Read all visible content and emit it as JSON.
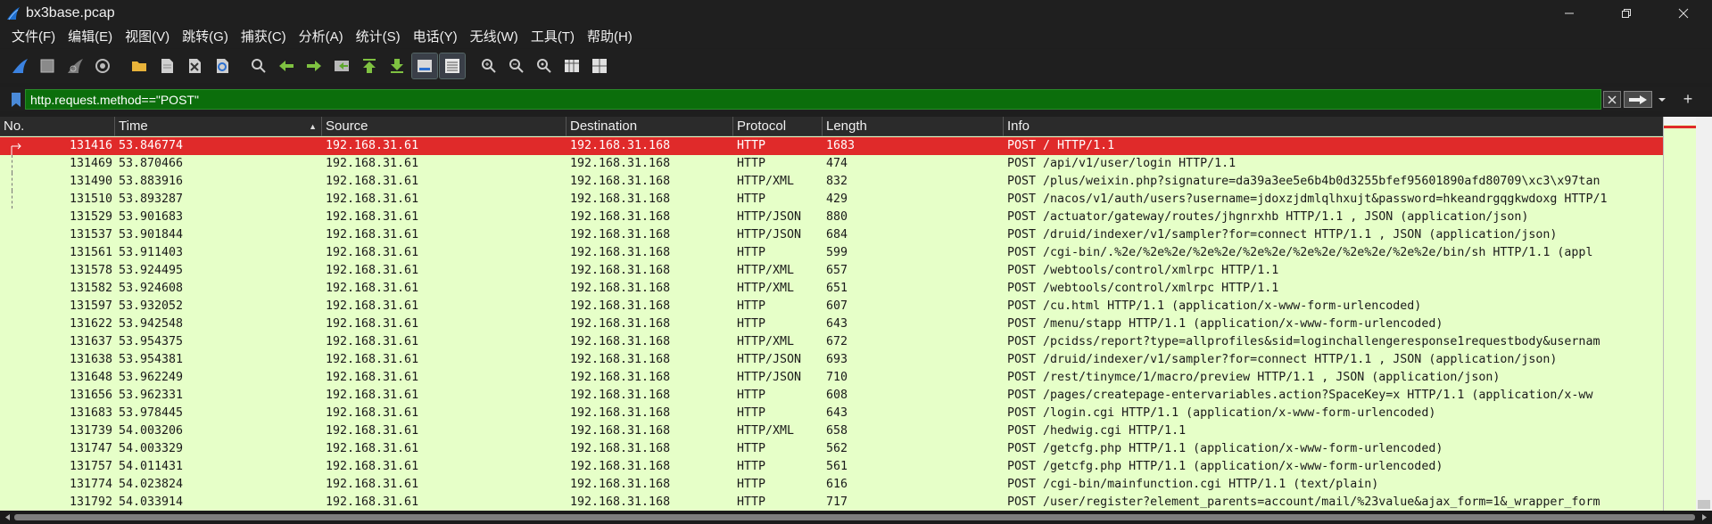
{
  "window": {
    "title": "bx3base.pcap",
    "minimize_icon": "minimize-icon",
    "maximize_icon": "restore-icon",
    "close_icon": "close-icon"
  },
  "menu": {
    "items": [
      {
        "label": "文件(F)"
      },
      {
        "label": "编辑(E)"
      },
      {
        "label": "视图(V)"
      },
      {
        "label": "跳转(G)"
      },
      {
        "label": "捕获(C)"
      },
      {
        "label": "分析(A)"
      },
      {
        "label": "统计(S)"
      },
      {
        "label": "电话(Y)"
      },
      {
        "label": "无线(W)"
      },
      {
        "label": "工具(T)"
      },
      {
        "label": "帮助(H)"
      }
    ]
  },
  "toolbar": {
    "buttons": [
      {
        "icon": "shark-fin-start-icon"
      },
      {
        "icon": "stop-square-icon"
      },
      {
        "icon": "restart-fin-icon"
      },
      {
        "icon": "capture-options-gear-icon"
      },
      {
        "icon": "open-folder-icon"
      },
      {
        "icon": "file-icon"
      },
      {
        "icon": "close-file-icon"
      },
      {
        "icon": "reload-icon"
      },
      {
        "icon": "search-icon"
      },
      {
        "icon": "back-arrow-icon"
      },
      {
        "icon": "forward-arrow-icon"
      },
      {
        "icon": "go-to-packet-icon"
      },
      {
        "icon": "first-packet-icon"
      },
      {
        "icon": "last-packet-icon"
      },
      {
        "icon": "autoscroll-icon"
      },
      {
        "icon": "colorize-icon"
      },
      {
        "icon": "zoom-in-icon"
      },
      {
        "icon": "zoom-out-icon"
      },
      {
        "icon": "zoom-reset-icon"
      },
      {
        "icon": "resize-columns-icon"
      },
      {
        "icon": "layout-icon"
      }
    ]
  },
  "filter": {
    "value": "http.request.method==\"POST\"",
    "background_color": "#0b6e0b"
  },
  "packet_list": {
    "columns": [
      "No.",
      "Time",
      "Source",
      "Destination",
      "Protocol",
      "Length",
      "Info"
    ],
    "sort_column": "Time",
    "selected_row_color": "#e02a2a",
    "row_color": "#e6ffc8",
    "rows": [
      {
        "no": "131416",
        "time": "53.846774",
        "src": "192.168.31.61",
        "dst": "192.168.31.168",
        "proto": "HTTP",
        "len": "1683",
        "info": "POST / HTTP/1.1",
        "selected": true
      },
      {
        "no": "131469",
        "time": "53.870466",
        "src": "192.168.31.61",
        "dst": "192.168.31.168",
        "proto": "HTTP",
        "len": "474",
        "info": "POST /api/v1/user/login HTTP/1.1"
      },
      {
        "no": "131490",
        "time": "53.883916",
        "src": "192.168.31.61",
        "dst": "192.168.31.168",
        "proto": "HTTP/XML",
        "len": "832",
        "info": "POST /plus/weixin.php?signature=da39a3ee5e6b4b0d3255bfef95601890afd80709\\xc3\\x97tan"
      },
      {
        "no": "131510",
        "time": "53.893287",
        "src": "192.168.31.61",
        "dst": "192.168.31.168",
        "proto": "HTTP",
        "len": "429",
        "info": "POST /nacos/v1/auth/users?username=jdoxzjdmlqlhxujt&password=hkeandrgqgkwdoxg HTTP/1"
      },
      {
        "no": "131529",
        "time": "53.901683",
        "src": "192.168.31.61",
        "dst": "192.168.31.168",
        "proto": "HTTP/JSON",
        "len": "880",
        "info": "POST /actuator/gateway/routes/jhgnrxhb HTTP/1.1 , JSON (application/json)"
      },
      {
        "no": "131537",
        "time": "53.901844",
        "src": "192.168.31.61",
        "dst": "192.168.31.168",
        "proto": "HTTP/JSON",
        "len": "684",
        "info": "POST /druid/indexer/v1/sampler?for=connect HTTP/1.1 , JSON (application/json)"
      },
      {
        "no": "131561",
        "time": "53.911403",
        "src": "192.168.31.61",
        "dst": "192.168.31.168",
        "proto": "HTTP",
        "len": "599",
        "info": "POST /cgi-bin/.%2e/%2e%2e/%2e%2e/%2e%2e/%2e%2e/%2e%2e/%2e%2e/bin/sh HTTP/1.1  (appl"
      },
      {
        "no": "131578",
        "time": "53.924495",
        "src": "192.168.31.61",
        "dst": "192.168.31.168",
        "proto": "HTTP/XML",
        "len": "657",
        "info": "POST /webtools/control/xmlrpc HTTP/1.1"
      },
      {
        "no": "131582",
        "time": "53.924608",
        "src": "192.168.31.61",
        "dst": "192.168.31.168",
        "proto": "HTTP/XML",
        "len": "651",
        "info": "POST /webtools/control/xmlrpc HTTP/1.1"
      },
      {
        "no": "131597",
        "time": "53.932052",
        "src": "192.168.31.61",
        "dst": "192.168.31.168",
        "proto": "HTTP",
        "len": "607",
        "info": "POST /cu.html HTTP/1.1  (application/x-www-form-urlencoded)"
      },
      {
        "no": "131622",
        "time": "53.942548",
        "src": "192.168.31.61",
        "dst": "192.168.31.168",
        "proto": "HTTP",
        "len": "643",
        "info": "POST /menu/stapp HTTP/1.1  (application/x-www-form-urlencoded)"
      },
      {
        "no": "131637",
        "time": "53.954375",
        "src": "192.168.31.61",
        "dst": "192.168.31.168",
        "proto": "HTTP/XML",
        "len": "672",
        "info": "POST /pcidss/report?type=allprofiles&sid=loginchallengeresponse1requestbody&usernam"
      },
      {
        "no": "131638",
        "time": "53.954381",
        "src": "192.168.31.61",
        "dst": "192.168.31.168",
        "proto": "HTTP/JSON",
        "len": "693",
        "info": "POST /druid/indexer/v1/sampler?for=connect HTTP/1.1 , JSON (application/json)"
      },
      {
        "no": "131648",
        "time": "53.962249",
        "src": "192.168.31.61",
        "dst": "192.168.31.168",
        "proto": "HTTP/JSON",
        "len": "710",
        "info": "POST /rest/tinymce/1/macro/preview HTTP/1.1 , JSON (application/json)"
      },
      {
        "no": "131656",
        "time": "53.962331",
        "src": "192.168.31.61",
        "dst": "192.168.31.168",
        "proto": "HTTP",
        "len": "608",
        "info": "POST /pages/createpage-entervariables.action?SpaceKey=x HTTP/1.1  (application/x-ww"
      },
      {
        "no": "131683",
        "time": "53.978445",
        "src": "192.168.31.61",
        "dst": "192.168.31.168",
        "proto": "HTTP",
        "len": "643",
        "info": "POST /login.cgi HTTP/1.1  (application/x-www-form-urlencoded)"
      },
      {
        "no": "131739",
        "time": "54.003206",
        "src": "192.168.31.61",
        "dst": "192.168.31.168",
        "proto": "HTTP/XML",
        "len": "658",
        "info": "POST /hedwig.cgi HTTP/1.1"
      },
      {
        "no": "131747",
        "time": "54.003329",
        "src": "192.168.31.61",
        "dst": "192.168.31.168",
        "proto": "HTTP",
        "len": "562",
        "info": "POST /getcfg.php HTTP/1.1  (application/x-www-form-urlencoded)"
      },
      {
        "no": "131757",
        "time": "54.011431",
        "src": "192.168.31.61",
        "dst": "192.168.31.168",
        "proto": "HTTP",
        "len": "561",
        "info": "POST /getcfg.php HTTP/1.1  (application/x-www-form-urlencoded)"
      },
      {
        "no": "131774",
        "time": "54.023824",
        "src": "192.168.31.61",
        "dst": "192.168.31.168",
        "proto": "HTTP",
        "len": "616",
        "info": "POST /cgi-bin/mainfunction.cgi HTTP/1.1  (text/plain)"
      },
      {
        "no": "131792",
        "time": "54.033914",
        "src": "192.168.31.61",
        "dst": "192.168.31.168",
        "proto": "HTTP",
        "len": "717",
        "info": "POST /user/register?element_parents=account/mail/%23value&ajax_form=1&_wrapper_form"
      }
    ]
  }
}
